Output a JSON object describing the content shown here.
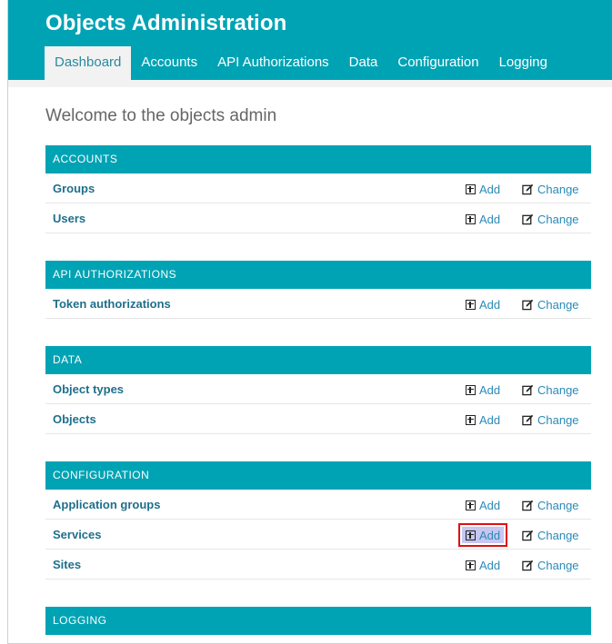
{
  "header": {
    "title": "Objects Administration",
    "nav": [
      "Dashboard",
      "Accounts",
      "API Authorizations",
      "Data",
      "Configuration",
      "Logging"
    ],
    "active_tab": "Dashboard"
  },
  "welcome": "Welcome to the objects admin",
  "links": {
    "add": "Add",
    "change": "Change"
  },
  "modules": [
    {
      "title": "ACCOUNTS",
      "rows": [
        "Groups",
        "Users"
      ]
    },
    {
      "title": "API AUTHORIZATIONS",
      "rows": [
        "Token authorizations"
      ]
    },
    {
      "title": "DATA",
      "rows": [
        "Object types",
        "Objects"
      ]
    },
    {
      "title": "CONFIGURATION",
      "rows": [
        "Application groups",
        "Services",
        "Sites"
      ]
    },
    {
      "title": "LOGGING",
      "rows": []
    }
  ],
  "highlighted": "Services add link",
  "colors": {
    "header": "#00a3b4",
    "link": "#2b8ab8",
    "highlight_border": "#e01010"
  }
}
